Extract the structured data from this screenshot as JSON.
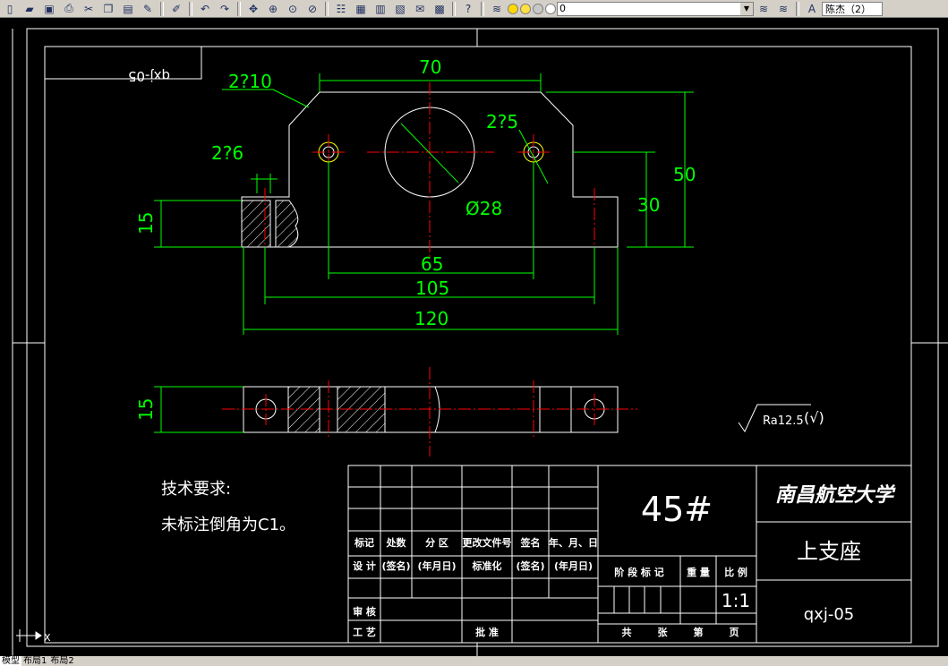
{
  "toolbar": {
    "icons": [
      "new-icon",
      "open-icon",
      "save-icon",
      "print-icon",
      "cut-icon",
      "copy-icon",
      "paste-icon",
      "match-properties-icon",
      "brush-icon",
      "undo-icon",
      "redo-icon",
      "pan-icon",
      "zoom-realtime-icon",
      "zoom-window-icon",
      "zoom-previous-icon",
      "properties-icon",
      "design-center-icon",
      "tool-palettes-icon",
      "sheet-set-icon",
      "markup-icon",
      "calculator-icon",
      "help-icon",
      "layer-manager-icon"
    ],
    "layer_value": "0",
    "user_value": "陈杰（2）"
  },
  "drawing": {
    "code_box": "qxj-05",
    "dims": {
      "top_width": "70",
      "chamfer": "2?10",
      "small_hole": "2?5",
      "slot": "2?6",
      "big_hole": "Ø28",
      "height_total": "50",
      "height_mid": "30",
      "left_height": "15",
      "hole_spacing": "65",
      "slot_spacing": "105",
      "total_width": "120",
      "plan_height": "15"
    },
    "surface_finish": "Ra12.5",
    "surface_finish_extra": "(√)",
    "tech_title": "技术要求:",
    "tech_note": "未标注倒角为C1。",
    "title_block": {
      "material": "45#",
      "university": "南昌航空大学",
      "part_name": "上支座",
      "drawing_no": "qxj-05",
      "scale": "1:1",
      "row_revision": [
        "标记",
        "处数",
        "分 区",
        "更改文件号",
        "签名",
        "年、月、日"
      ],
      "row_design": [
        "设 计",
        "(签名)",
        "(年月日)",
        "标准化",
        "(签名)",
        "(年月日)"
      ],
      "review": "审 核",
      "process": "工 艺",
      "approve": "批 准",
      "stage_headers": [
        "阶 段 标 记",
        "重 量",
        "比 例"
      ],
      "sheet_row": [
        "共",
        "张",
        "第",
        "页"
      ]
    }
  },
  "tabs": [
    "模型",
    "布局1",
    "布局2"
  ]
}
